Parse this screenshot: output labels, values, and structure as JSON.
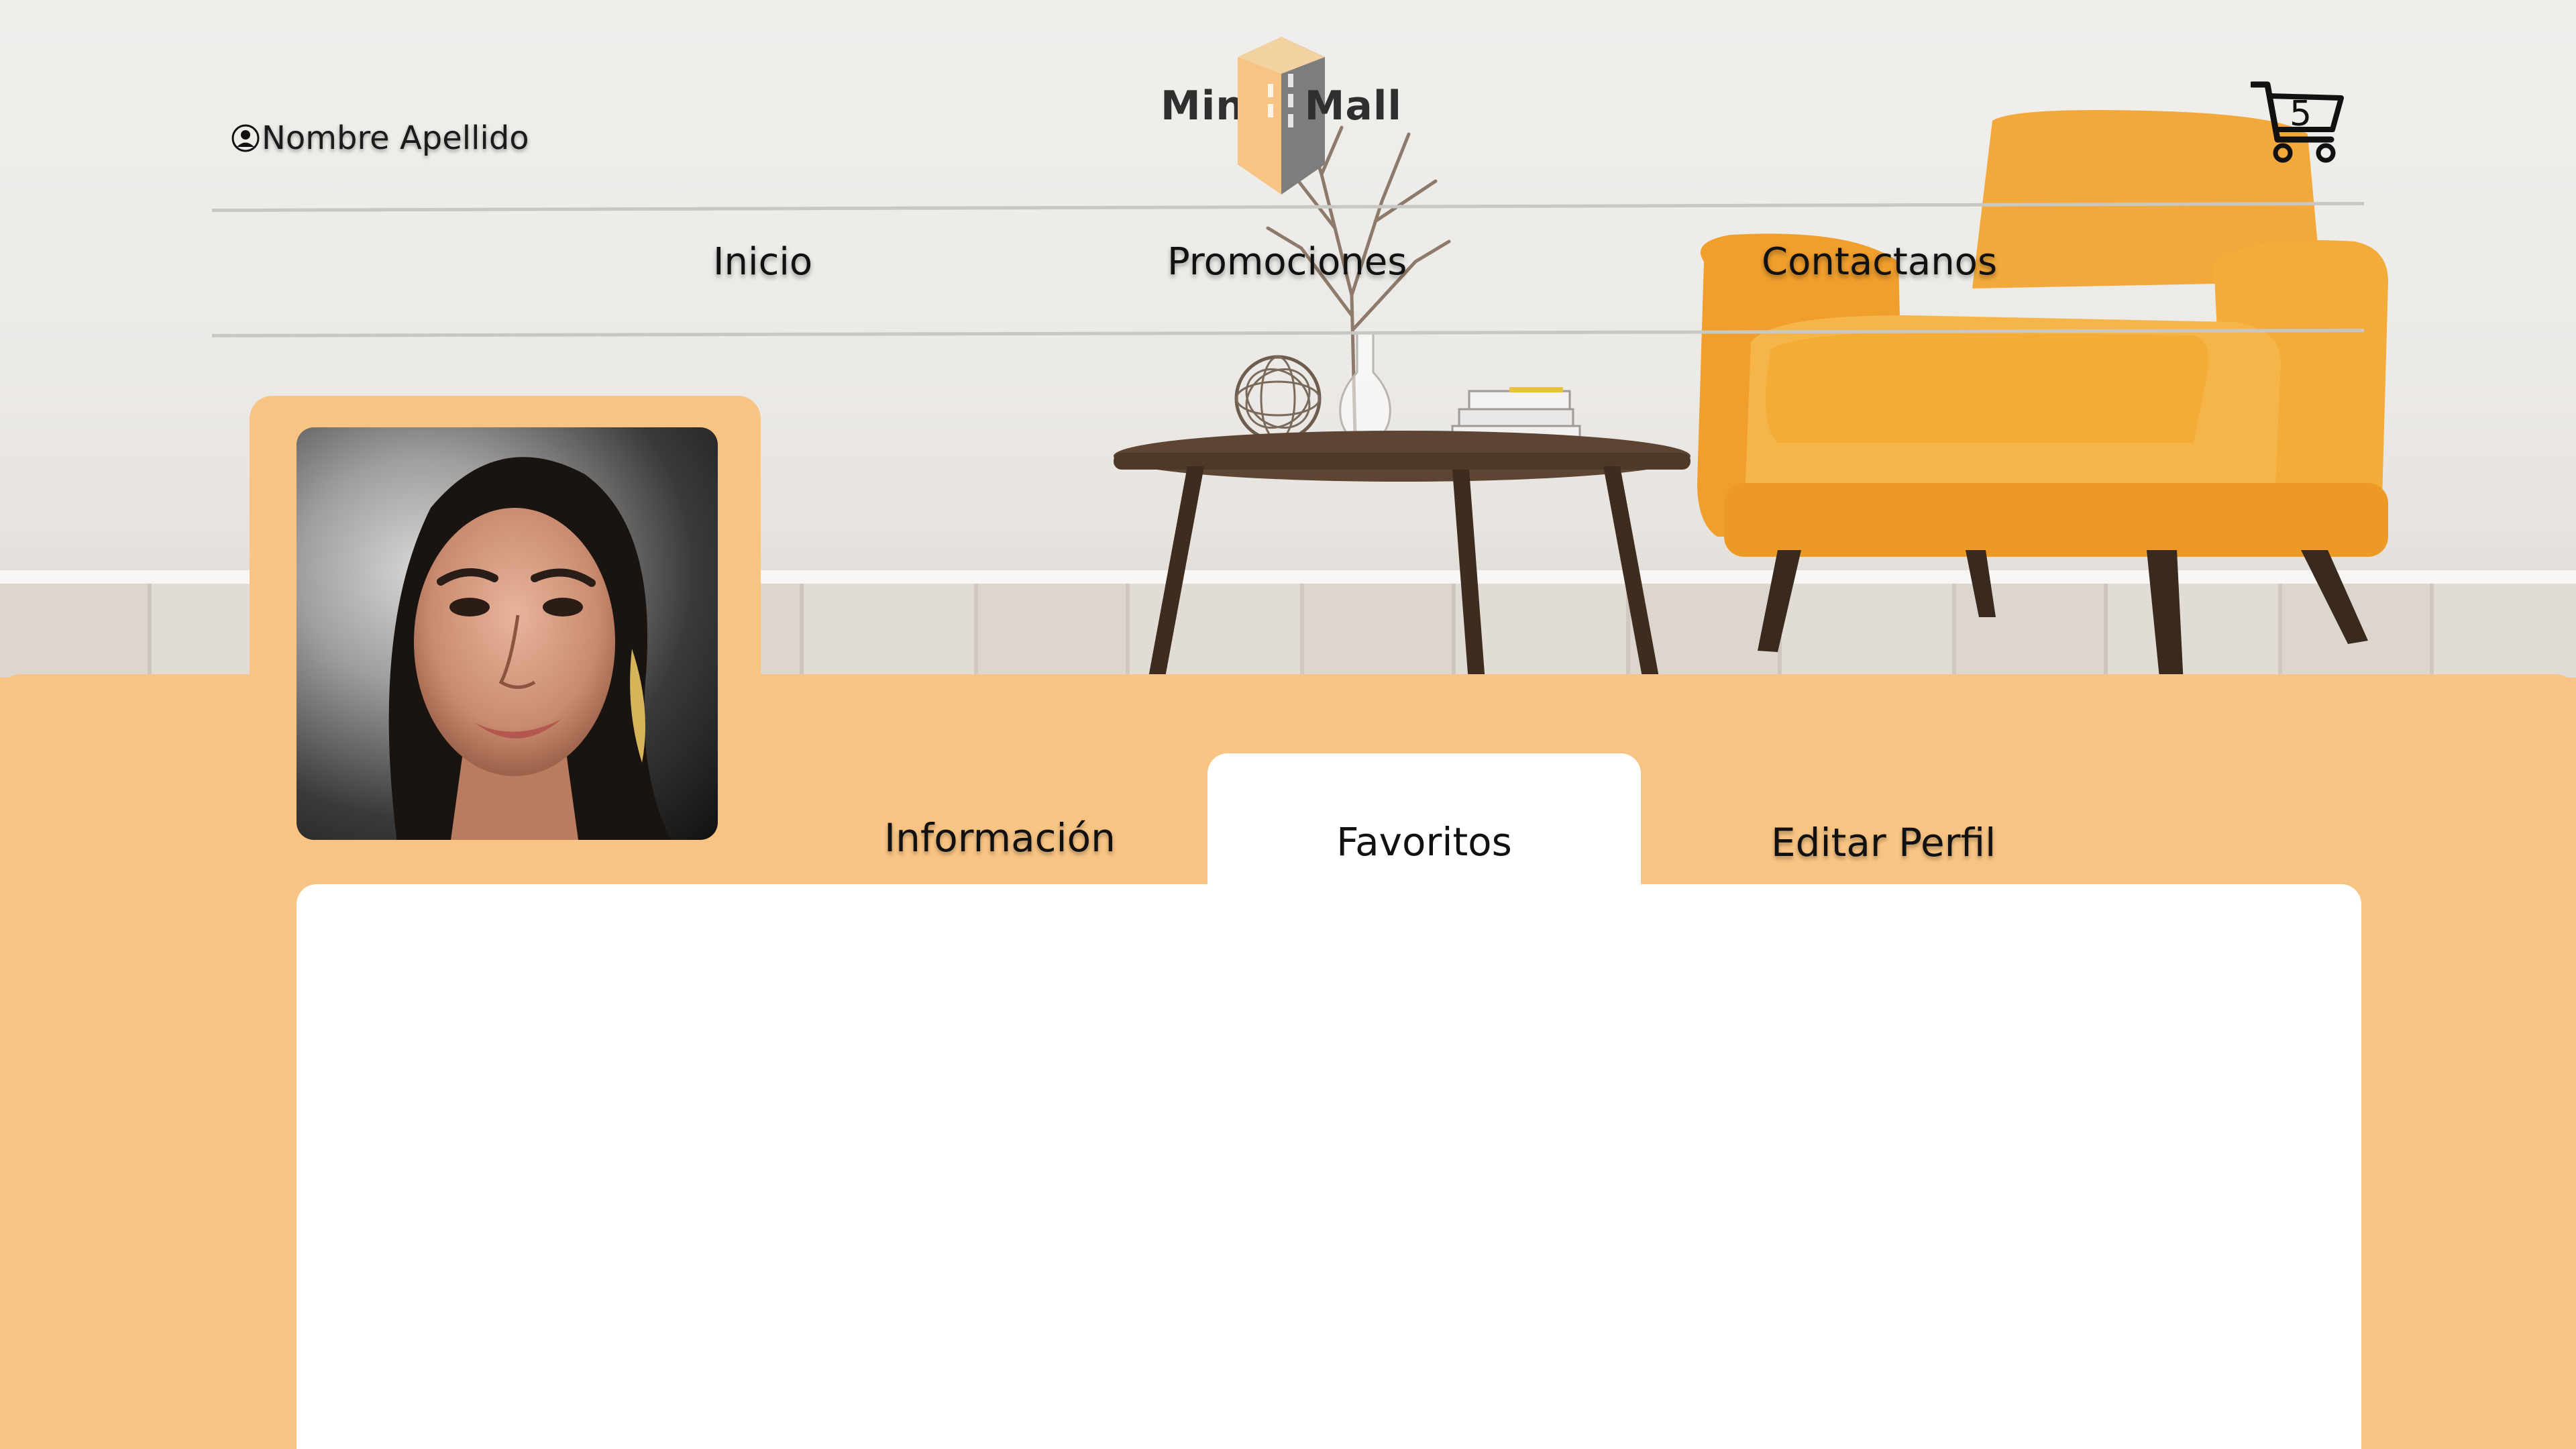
{
  "header": {
    "user_name": "Nombre Apellido",
    "user_icon": "user-circle-icon",
    "logo": {
      "left_text": "Mini",
      "right_text": "Mall",
      "mark_icon": "building-icon"
    },
    "cart": {
      "icon": "shopping-cart-icon",
      "count": "5"
    }
  },
  "nav": {
    "items": [
      {
        "label": "Inicio"
      },
      {
        "label": "Promociones"
      },
      {
        "label": "Contactanos"
      }
    ]
  },
  "profile": {
    "avatar_alt": "profile-photo",
    "tabs": [
      {
        "label": "Información",
        "active": false
      },
      {
        "label": "Favoritos",
        "active": true
      },
      {
        "label": "Editar Perfil",
        "active": false
      }
    ]
  },
  "colors": {
    "panel": "#f8c483",
    "content": "#ffffff",
    "text": "#111111",
    "chair": "#f2a93b"
  }
}
